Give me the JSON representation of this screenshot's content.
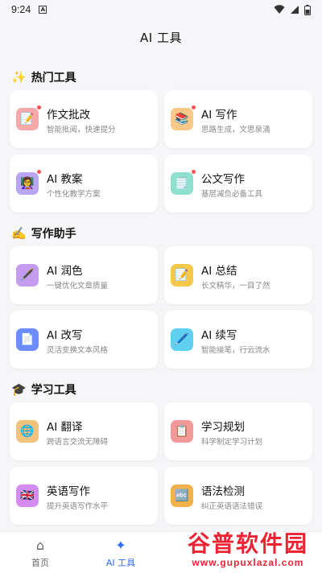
{
  "statusbar": {
    "time": "9:24",
    "notif": "A"
  },
  "app": {
    "title": "AI 工具"
  },
  "sections": [
    {
      "emoji": "✨",
      "title": "热门工具"
    },
    {
      "emoji": "✍️",
      "title": "写作助手"
    },
    {
      "emoji": "🎓",
      "title": "学习工具"
    }
  ],
  "cards": [
    {
      "title": "作文批改",
      "subtitle": "智能批阅，快速提分",
      "icon": "📝",
      "badge": true,
      "color": "#f7a8a8"
    },
    {
      "title": "AI 写作",
      "subtitle": "思路生成，文思泉涌",
      "icon": "📚",
      "badge": true,
      "color": "#f9c98a"
    },
    {
      "title": "AI 教案",
      "subtitle": "个性化教学方案",
      "icon": "👩‍🏫",
      "badge": true,
      "color": "#b9a6f2"
    },
    {
      "title": "公文写作",
      "subtitle": "基层减负必备工具",
      "icon": "🗒️",
      "badge": true,
      "color": "#8fe0cf"
    },
    {
      "title": "AI 润色",
      "subtitle": "一键优化文章质量",
      "icon": "🖋️",
      "badge": false,
      "color": "#c59bf0"
    },
    {
      "title": "AI 总结",
      "subtitle": "长文精华，一目了然",
      "icon": "📝",
      "badge": false,
      "color": "#f4c94a"
    },
    {
      "title": "AI 改写",
      "subtitle": "灵活变换文本风格",
      "icon": "📄",
      "badge": false,
      "color": "#6c8cff"
    },
    {
      "title": "AI 续写",
      "subtitle": "智能接笔，行云流水",
      "icon": "🖊️",
      "badge": false,
      "color": "#5fd0f0"
    },
    {
      "title": "AI 翻译",
      "subtitle": "跨语言交流无障碍",
      "icon": "🌐",
      "badge": false,
      "color": "#f1c27b"
    },
    {
      "title": "学习规划",
      "subtitle": "科学制定学习计划",
      "icon": "📋",
      "badge": false,
      "color": "#f29a9a"
    },
    {
      "title": "英语写作",
      "subtitle": "提升英语写作水平",
      "icon": "🇬🇧",
      "badge": false,
      "color": "#d58cf0"
    },
    {
      "title": "语法检测",
      "subtitle": "纠正英语语法错误",
      "icon": "🔤",
      "badge": false,
      "color": "#f2b14a"
    }
  ],
  "tabs": [
    {
      "label": "首页",
      "icon": "⌂",
      "active": false
    },
    {
      "label": "AI 工具",
      "icon": "✦",
      "active": true
    }
  ],
  "watermark": {
    "line1": "谷普软件园",
    "line2": "www.gupuxlazal.com"
  }
}
